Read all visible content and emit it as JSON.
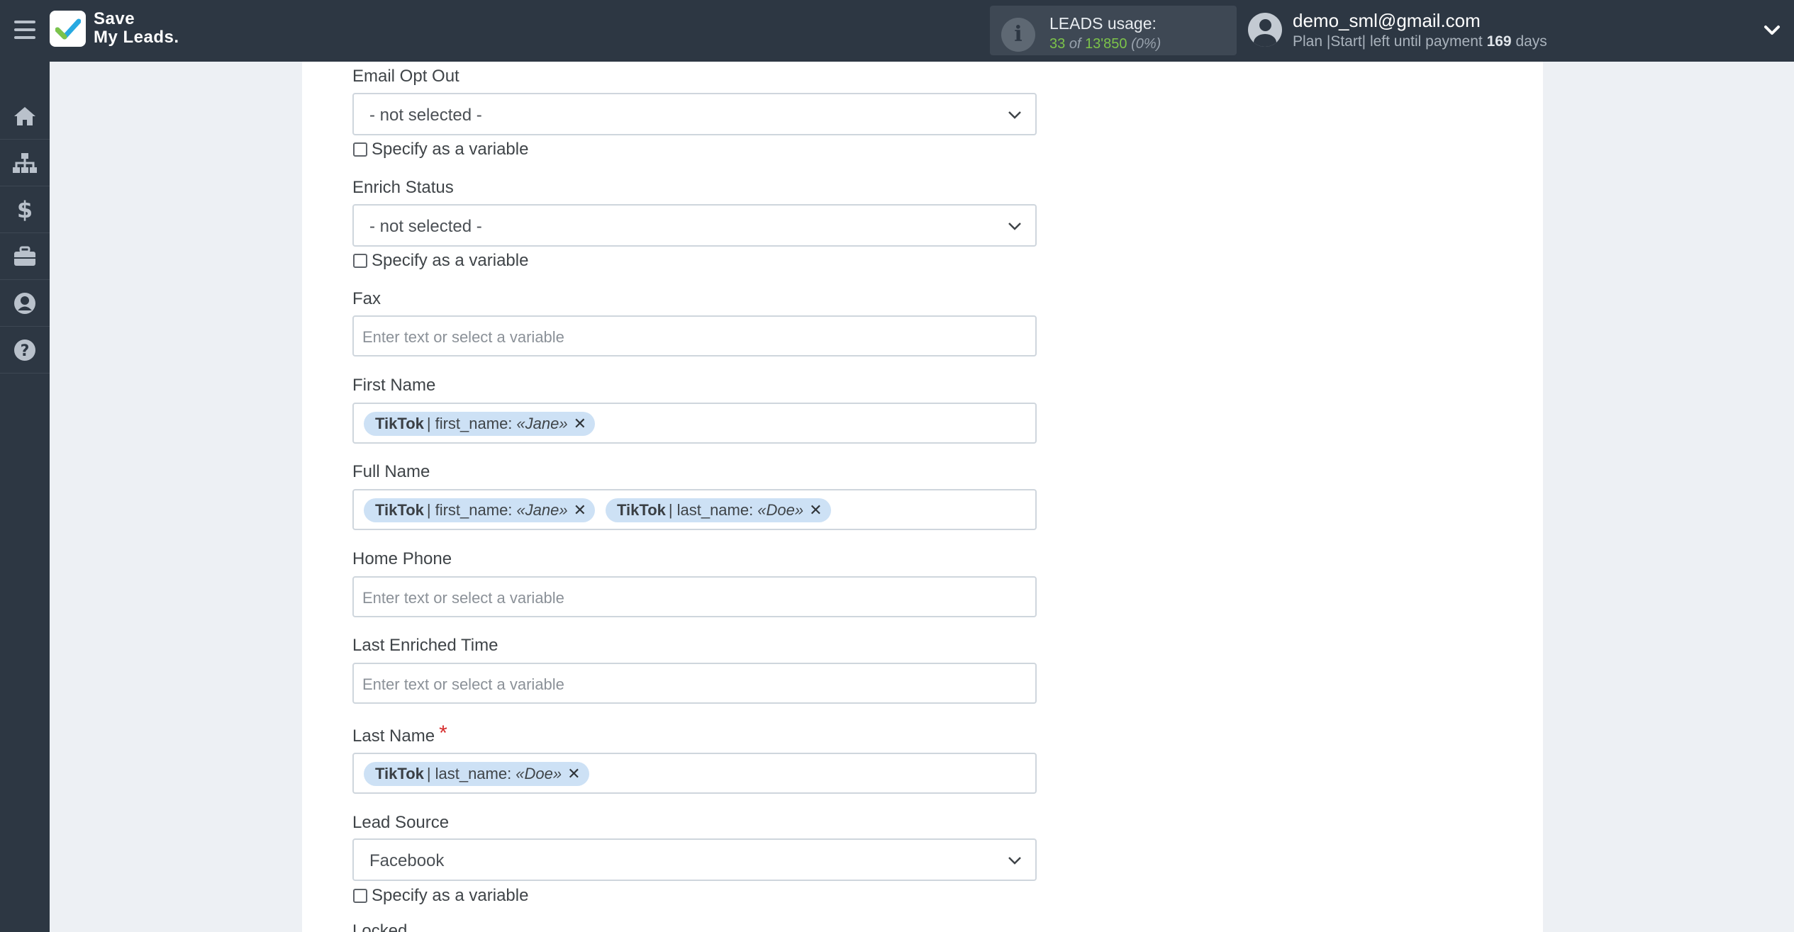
{
  "app": {
    "logo_line1": "Save",
    "logo_line2": "My Leads."
  },
  "leads": {
    "title": "LEADS usage:",
    "used": "33",
    "of": "of",
    "total": "13'850",
    "percent": "(0%)"
  },
  "user": {
    "email": "demo_sml@gmail.com",
    "plan_text": "Plan |Start| left until payment",
    "days": "169",
    "days_suffix": "days"
  },
  "sidebar": {
    "items": [
      "home-icon",
      "sitemap-icon",
      "dollar-icon",
      "briefcase-icon",
      "user-circle-icon",
      "help-icon"
    ]
  },
  "form": {
    "email_opt_out": {
      "label": "Email Opt Out",
      "value": "- not selected -",
      "checkbox": "Specify as a variable"
    },
    "enrich_status": {
      "label": "Enrich Status",
      "value": "- not selected -",
      "checkbox": "Specify as a variable"
    },
    "fax": {
      "label": "Fax",
      "placeholder": "Enter text or select a variable"
    },
    "first_name": {
      "label": "First Name",
      "tags": [
        {
          "source": "TikTok",
          "sep": "|",
          "field": "first_name:",
          "value": "«Jane»"
        }
      ]
    },
    "full_name": {
      "label": "Full Name",
      "tags": [
        {
          "source": "TikTok",
          "sep": "|",
          "field": "first_name:",
          "value": "«Jane»"
        },
        {
          "source": "TikTok",
          "sep": "|",
          "field": "last_name:",
          "value": "«Doe»"
        }
      ]
    },
    "home_phone": {
      "label": "Home Phone",
      "placeholder": "Enter text or select a variable"
    },
    "last_enriched_time": {
      "label": "Last Enriched Time",
      "placeholder": "Enter text or select a variable"
    },
    "last_name": {
      "label": "Last Name",
      "required": "*",
      "tags": [
        {
          "source": "TikTok",
          "sep": "|",
          "field": "last_name:",
          "value": "«Doe»"
        }
      ]
    },
    "lead_source": {
      "label": "Lead Source",
      "value": "Facebook",
      "checkbox": "Specify as a variable"
    },
    "locked": {
      "label": "Locked"
    }
  },
  "colors": {
    "header_bg": "#2d3743",
    "tag_bg": "#cde1f5",
    "accent_green": "#7cc34a",
    "required_red": "#d62d2d"
  }
}
